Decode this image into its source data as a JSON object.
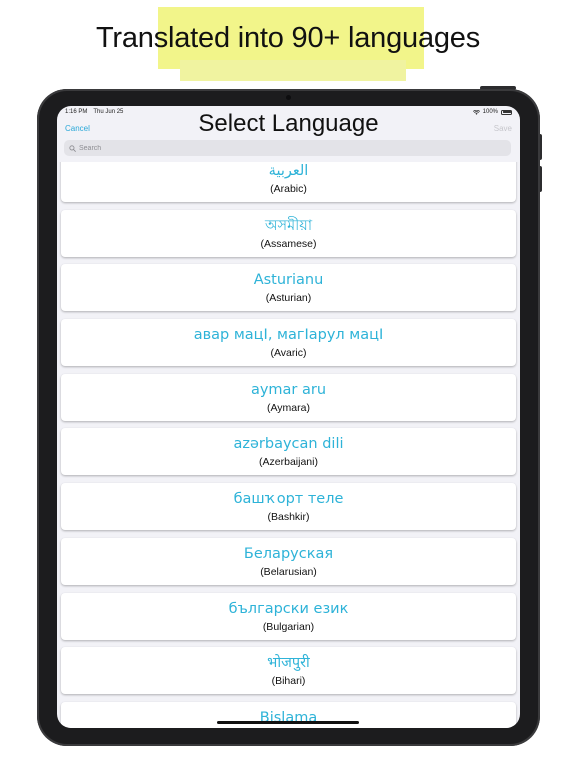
{
  "promo": {
    "headline": "Translated into 90+ languages",
    "highlight_color": "#f2f58a"
  },
  "status_bar": {
    "time": "1:16 PM",
    "date": "Thu Jun 25",
    "battery": "100%"
  },
  "nav": {
    "cancel_label": "Cancel",
    "title": "Select Language",
    "save_label": "Save"
  },
  "search": {
    "placeholder": "Search"
  },
  "colors": {
    "accent": "#2eb3d8",
    "disabled": "#c7c7cc",
    "background": "#f2f2f7"
  },
  "languages": [
    {
      "native": "العربية",
      "english": "(Arabic)"
    },
    {
      "native": "অসমীয়া",
      "english": "(Assamese)"
    },
    {
      "native": "Asturianu",
      "english": "(Asturian)"
    },
    {
      "native": "авар мацӀ, магӀарул мацӀ",
      "english": "(Avaric)"
    },
    {
      "native": "aymar aru",
      "english": "(Aymara)"
    },
    {
      "native": "azərbaycan dili",
      "english": "(Azerbaijani)"
    },
    {
      "native": "башҡорт теле",
      "english": "(Bashkir)"
    },
    {
      "native": "Беларуская",
      "english": "(Belarusian)"
    },
    {
      "native": "български език",
      "english": "(Bulgarian)"
    },
    {
      "native": "भोजपुरी",
      "english": "(Bihari)"
    },
    {
      "native": "Bislama",
      "english": ""
    }
  ]
}
